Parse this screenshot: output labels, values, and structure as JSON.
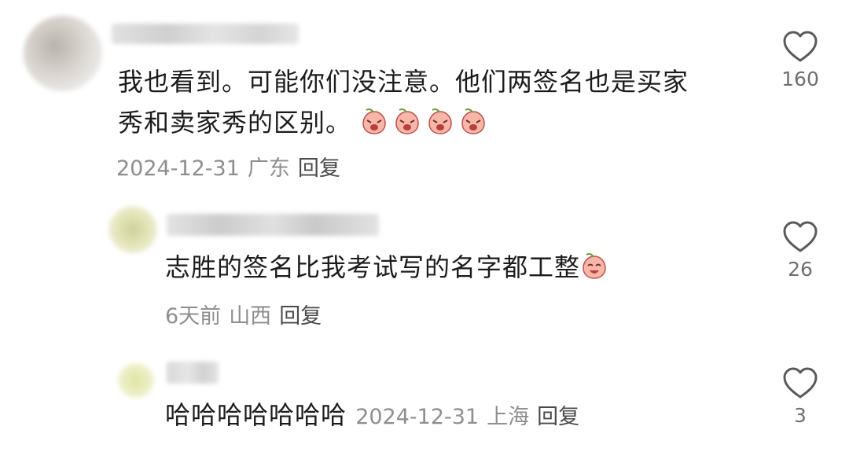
{
  "comments": [
    {
      "text_line1": "我也看到。可能你们没注意。他们两签名也是买家",
      "text_line2": "秀和卖家秀的区别。",
      "date": "2024-12-31",
      "location": "广东",
      "reply_label": "回复",
      "likes": "160"
    },
    {
      "text": "志胜的签名比我考试写的名字都工整",
      "date": "6天前",
      "location": "山西",
      "reply_label": "回复",
      "likes": "26"
    },
    {
      "text": "哈哈哈哈哈哈哈",
      "date": "2024-12-31",
      "location": "上海",
      "reply_label": "回复",
      "likes": "3"
    }
  ],
  "icons": {
    "like": "heart-outline-icon",
    "emoji_crying": "crying-peach-emoji",
    "emoji_laughing": "laughing-peach-emoji"
  },
  "colors": {
    "text": "#1c1c1c",
    "meta": "#8e8e8e",
    "reply": "#4a4a4a",
    "heart_stroke": "#5a5a5a",
    "emoji_face": "#f6b7a8",
    "emoji_leaf": "#6e9e3e"
  }
}
